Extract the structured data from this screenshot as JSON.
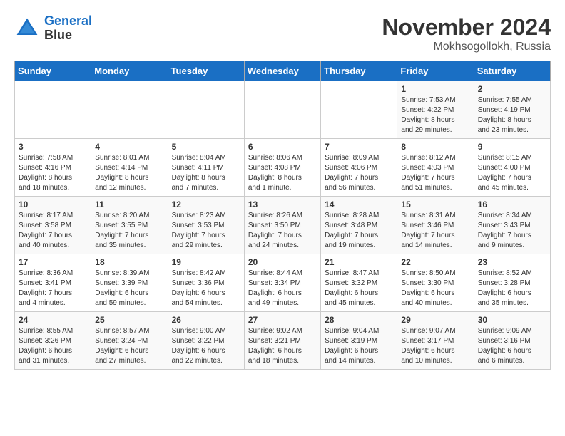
{
  "header": {
    "logo_line1": "General",
    "logo_line2": "Blue",
    "month": "November 2024",
    "location": "Mokhsogollokh, Russia"
  },
  "weekdays": [
    "Sunday",
    "Monday",
    "Tuesday",
    "Wednesday",
    "Thursday",
    "Friday",
    "Saturday"
  ],
  "weeks": [
    [
      {
        "day": "",
        "info": ""
      },
      {
        "day": "",
        "info": ""
      },
      {
        "day": "",
        "info": ""
      },
      {
        "day": "",
        "info": ""
      },
      {
        "day": "",
        "info": ""
      },
      {
        "day": "1",
        "info": "Sunrise: 7:53 AM\nSunset: 4:22 PM\nDaylight: 8 hours\nand 29 minutes."
      },
      {
        "day": "2",
        "info": "Sunrise: 7:55 AM\nSunset: 4:19 PM\nDaylight: 8 hours\nand 23 minutes."
      }
    ],
    [
      {
        "day": "3",
        "info": "Sunrise: 7:58 AM\nSunset: 4:16 PM\nDaylight: 8 hours\nand 18 minutes."
      },
      {
        "day": "4",
        "info": "Sunrise: 8:01 AM\nSunset: 4:14 PM\nDaylight: 8 hours\nand 12 minutes."
      },
      {
        "day": "5",
        "info": "Sunrise: 8:04 AM\nSunset: 4:11 PM\nDaylight: 8 hours\nand 7 minutes."
      },
      {
        "day": "6",
        "info": "Sunrise: 8:06 AM\nSunset: 4:08 PM\nDaylight: 8 hours\nand 1 minute."
      },
      {
        "day": "7",
        "info": "Sunrise: 8:09 AM\nSunset: 4:06 PM\nDaylight: 7 hours\nand 56 minutes."
      },
      {
        "day": "8",
        "info": "Sunrise: 8:12 AM\nSunset: 4:03 PM\nDaylight: 7 hours\nand 51 minutes."
      },
      {
        "day": "9",
        "info": "Sunrise: 8:15 AM\nSunset: 4:00 PM\nDaylight: 7 hours\nand 45 minutes."
      }
    ],
    [
      {
        "day": "10",
        "info": "Sunrise: 8:17 AM\nSunset: 3:58 PM\nDaylight: 7 hours\nand 40 minutes."
      },
      {
        "day": "11",
        "info": "Sunrise: 8:20 AM\nSunset: 3:55 PM\nDaylight: 7 hours\nand 35 minutes."
      },
      {
        "day": "12",
        "info": "Sunrise: 8:23 AM\nSunset: 3:53 PM\nDaylight: 7 hours\nand 29 minutes."
      },
      {
        "day": "13",
        "info": "Sunrise: 8:26 AM\nSunset: 3:50 PM\nDaylight: 7 hours\nand 24 minutes."
      },
      {
        "day": "14",
        "info": "Sunrise: 8:28 AM\nSunset: 3:48 PM\nDaylight: 7 hours\nand 19 minutes."
      },
      {
        "day": "15",
        "info": "Sunrise: 8:31 AM\nSunset: 3:46 PM\nDaylight: 7 hours\nand 14 minutes."
      },
      {
        "day": "16",
        "info": "Sunrise: 8:34 AM\nSunset: 3:43 PM\nDaylight: 7 hours\nand 9 minutes."
      }
    ],
    [
      {
        "day": "17",
        "info": "Sunrise: 8:36 AM\nSunset: 3:41 PM\nDaylight: 7 hours\nand 4 minutes."
      },
      {
        "day": "18",
        "info": "Sunrise: 8:39 AM\nSunset: 3:39 PM\nDaylight: 6 hours\nand 59 minutes."
      },
      {
        "day": "19",
        "info": "Sunrise: 8:42 AM\nSunset: 3:36 PM\nDaylight: 6 hours\nand 54 minutes."
      },
      {
        "day": "20",
        "info": "Sunrise: 8:44 AM\nSunset: 3:34 PM\nDaylight: 6 hours\nand 49 minutes."
      },
      {
        "day": "21",
        "info": "Sunrise: 8:47 AM\nSunset: 3:32 PM\nDaylight: 6 hours\nand 45 minutes."
      },
      {
        "day": "22",
        "info": "Sunrise: 8:50 AM\nSunset: 3:30 PM\nDaylight: 6 hours\nand 40 minutes."
      },
      {
        "day": "23",
        "info": "Sunrise: 8:52 AM\nSunset: 3:28 PM\nDaylight: 6 hours\nand 35 minutes."
      }
    ],
    [
      {
        "day": "24",
        "info": "Sunrise: 8:55 AM\nSunset: 3:26 PM\nDaylight: 6 hours\nand 31 minutes."
      },
      {
        "day": "25",
        "info": "Sunrise: 8:57 AM\nSunset: 3:24 PM\nDaylight: 6 hours\nand 27 minutes."
      },
      {
        "day": "26",
        "info": "Sunrise: 9:00 AM\nSunset: 3:22 PM\nDaylight: 6 hours\nand 22 minutes."
      },
      {
        "day": "27",
        "info": "Sunrise: 9:02 AM\nSunset: 3:21 PM\nDaylight: 6 hours\nand 18 minutes."
      },
      {
        "day": "28",
        "info": "Sunrise: 9:04 AM\nSunset: 3:19 PM\nDaylight: 6 hours\nand 14 minutes."
      },
      {
        "day": "29",
        "info": "Sunrise: 9:07 AM\nSunset: 3:17 PM\nDaylight: 6 hours\nand 10 minutes."
      },
      {
        "day": "30",
        "info": "Sunrise: 9:09 AM\nSunset: 3:16 PM\nDaylight: 6 hours\nand 6 minutes."
      }
    ]
  ]
}
